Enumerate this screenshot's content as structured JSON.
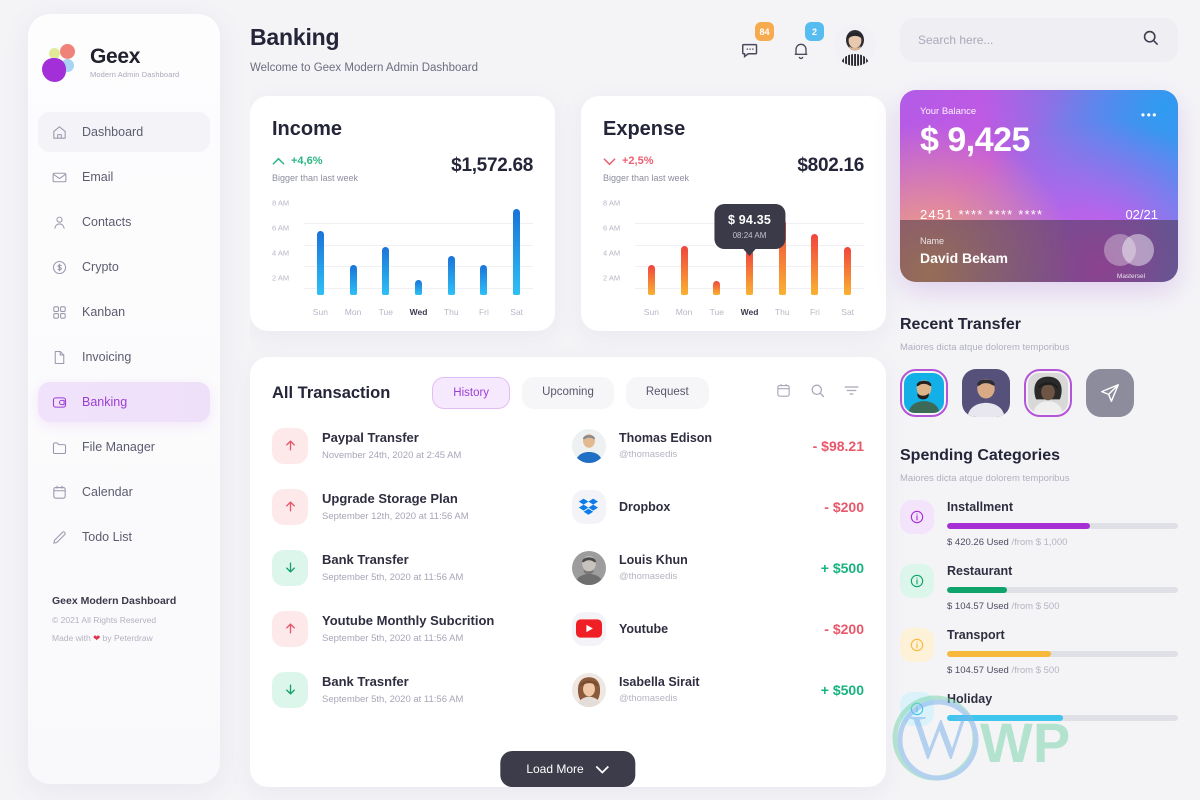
{
  "brand": {
    "name": "Geex",
    "tagline": "Modern Admin Dashboard"
  },
  "sidebar": {
    "items": [
      {
        "label": "Dashboard",
        "icon": "home-icon",
        "active": false
      },
      {
        "label": "Email",
        "icon": "mail-icon",
        "active": false
      },
      {
        "label": "Contacts",
        "icon": "user-icon",
        "active": false
      },
      {
        "label": "Crypto",
        "icon": "dollar-circle-icon",
        "active": false
      },
      {
        "label": "Kanban",
        "icon": "grid-icon",
        "active": false
      },
      {
        "label": "Invoicing",
        "icon": "file-icon",
        "active": false
      },
      {
        "label": "Banking",
        "icon": "wallet-icon",
        "active": true
      },
      {
        "label": "File Manager",
        "icon": "folder-icon",
        "active": false
      },
      {
        "label": "Calendar",
        "icon": "calendar-icon",
        "active": false
      },
      {
        "label": "Todo List",
        "icon": "pencil-icon",
        "active": false
      }
    ],
    "footer": {
      "title": "Geex Modern Dashboard",
      "copyright": "© 2021 All Rights Reserved",
      "made_prefix": "Made with",
      "made_suffix": "by Peterdraw"
    }
  },
  "header": {
    "title": "Banking",
    "subtitle": "Welcome to Geex Modern Admin Dashboard",
    "messages_badge": "84",
    "notifications_badge": "2"
  },
  "search": {
    "placeholder": "Search here...",
    "value": ""
  },
  "income": {
    "title": "Income",
    "change": "+4,6%",
    "change_direction": "up",
    "change_note": "Bigger than last week",
    "amount": "$1,572.68"
  },
  "expense": {
    "title": "Expense",
    "change": "+2,5%",
    "change_direction": "down",
    "change_note": "Bigger than last week",
    "amount": "$802.16",
    "tooltip_value": "$ 94.35",
    "tooltip_time": "08:24 AM"
  },
  "chart_data": [
    {
      "type": "bar",
      "title": "Income",
      "categories": [
        "Sun",
        "Mon",
        "Tue",
        "Wed",
        "Thu",
        "Fri",
        "Sat"
      ],
      "values": [
        6.5,
        3.8,
        5.2,
        2.6,
        4.5,
        3.8,
        8.2
      ],
      "highlight_category": "Wed",
      "ytick_labels": [
        "8 AM",
        "6 AM",
        "4 AM",
        "2 AM"
      ],
      "ytick_values": [
        8,
        6,
        4,
        2
      ],
      "ylim": [
        1.4,
        9
      ],
      "xlabel": "",
      "ylabel": "",
      "grid": true,
      "legend": "none",
      "series_color": "#1a73d8"
    },
    {
      "type": "bar",
      "title": "Expense",
      "categories": [
        "Sun",
        "Mon",
        "Tue",
        "Wed",
        "Thu",
        "Fri",
        "Sat"
      ],
      "values": [
        3.8,
        5.3,
        2.5,
        5.0,
        7.3,
        6.2,
        5.2
      ],
      "highlight_category": "Wed",
      "ytick_labels": [
        "8 AM",
        "6 AM",
        "4 AM",
        "2 AM"
      ],
      "ytick_values": [
        8,
        6,
        4,
        2
      ],
      "ylim": [
        1.4,
        9
      ],
      "xlabel": "",
      "ylabel": "",
      "grid": true,
      "legend": "none",
      "series_color": "#f0443d",
      "annotation": {
        "category": "Wed",
        "value_label": "$ 94.35",
        "time_label": "08:24 AM"
      }
    }
  ],
  "transactions": {
    "title": "All Transaction",
    "tabs": [
      {
        "label": "History",
        "active": true
      },
      {
        "label": "Upcoming",
        "active": false
      },
      {
        "label": "Request",
        "active": false
      }
    ],
    "tools": [
      "calendar-icon",
      "search-icon",
      "filter-icon"
    ],
    "rows": [
      {
        "name": "Paypal Transfer",
        "date": "November 24th, 2020 at 2:45 AM",
        "direction": "out",
        "person": "Thomas Edison",
        "handle": "@thomasedis",
        "amount": "- $98.21",
        "amount_sign": "neg",
        "avatar": "photo-man-blue"
      },
      {
        "name": "Upgrade Storage Plan",
        "date": "September 12th, 2020 at 11:56 AM",
        "direction": "out",
        "person": "Dropbox",
        "handle": "",
        "amount": "- $200",
        "amount_sign": "neg",
        "avatar": "dropbox-logo"
      },
      {
        "name": "Bank Transfer",
        "date": "September 5th, 2020 at 11:56 AM",
        "direction": "in",
        "person": "Louis Khun",
        "handle": "@thomasedis",
        "amount": "+ $500",
        "amount_sign": "pos",
        "avatar": "photo-man-gray"
      },
      {
        "name": "Youtube Monthly Subcrition",
        "date": "September 5th, 2020 at 11:56 AM",
        "direction": "out",
        "person": "Youtube",
        "handle": "",
        "amount": "- $200",
        "amount_sign": "neg",
        "avatar": "youtube-logo"
      },
      {
        "name": "Bank Trasnfer",
        "date": "September 5th, 2020 at 11:56 AM",
        "direction": "in",
        "person": "Isabella Sirait",
        "handle": "@thomasedis",
        "amount": "+ $500",
        "amount_sign": "pos",
        "avatar": "photo-woman"
      }
    ],
    "load_more": "Load More"
  },
  "balance_card": {
    "label": "Your Balance",
    "amount": "$ 9,425",
    "number": "2451 **** **** ****",
    "expiry": "02/21",
    "name_label": "Name",
    "name": "David Bekam",
    "network": "Mastersel",
    "menu_icon": "more-dots-icon"
  },
  "recent_transfer": {
    "title": "Recent Transfer",
    "subtitle": "Maiores dicta atque dolorem temporibus",
    "avatars": [
      {
        "name": "contact-1",
        "ring": true
      },
      {
        "name": "contact-2",
        "ring": false
      },
      {
        "name": "contact-3",
        "ring": true
      }
    ],
    "send_icon": "send-icon"
  },
  "spending": {
    "title": "Spending Categories",
    "subtitle": "Maiores dicta atque dolorem temporibus",
    "categories": [
      {
        "name": "Installment",
        "used": "$ 420.26 Used",
        "of": "/from $ 1,000",
        "percent": 62,
        "color": "#a62fd4",
        "icon_bg": "#f3e4fb",
        "icon_color": "#a62fd4"
      },
      {
        "name": "Restaurant",
        "used": "$ 104.57 Used",
        "of": "/from $ 500",
        "percent": 26,
        "color": "#0fa36c",
        "icon_bg": "#ddf6eb",
        "icon_color": "#0fa36c"
      },
      {
        "name": "Transport",
        "used": "$ 104.57 Used",
        "of": "/from $ 500",
        "percent": 45,
        "color": "#f6b93b",
        "icon_bg": "#fdf1d8",
        "icon_color": "#f6b93b"
      },
      {
        "name": "Holiday",
        "used": "",
        "of": "",
        "percent": 50,
        "color": "#3ec6ef",
        "icon_bg": "#dcf2fb",
        "icon_color": "#3ec6ef"
      }
    ]
  }
}
